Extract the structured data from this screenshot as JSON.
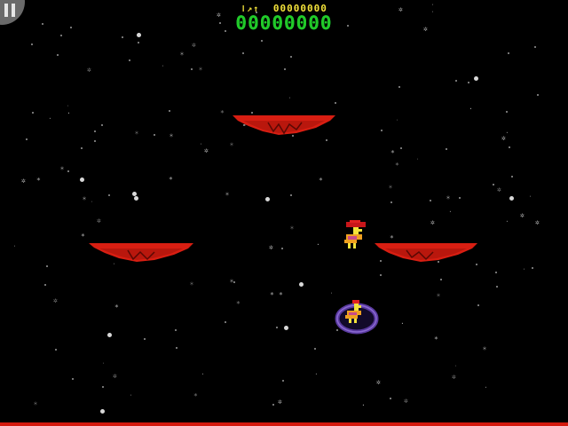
{
  "hud": {
    "hiscore_icon": "trophy-icon",
    "hiscore_value": "00000000",
    "score_value": "00000000"
  },
  "controls": {
    "pause_icon": "pause-icon"
  },
  "colors": {
    "background": "#000000",
    "hiscore": "#f2e23a",
    "score": "#22c928",
    "platform": "#d81e12",
    "lava": "#d41a0e",
    "bubble": "#5a3aa0"
  },
  "entities": {
    "platforms": 4,
    "players": [
      "player-ostrich-rider",
      "player-in-bubble"
    ]
  }
}
